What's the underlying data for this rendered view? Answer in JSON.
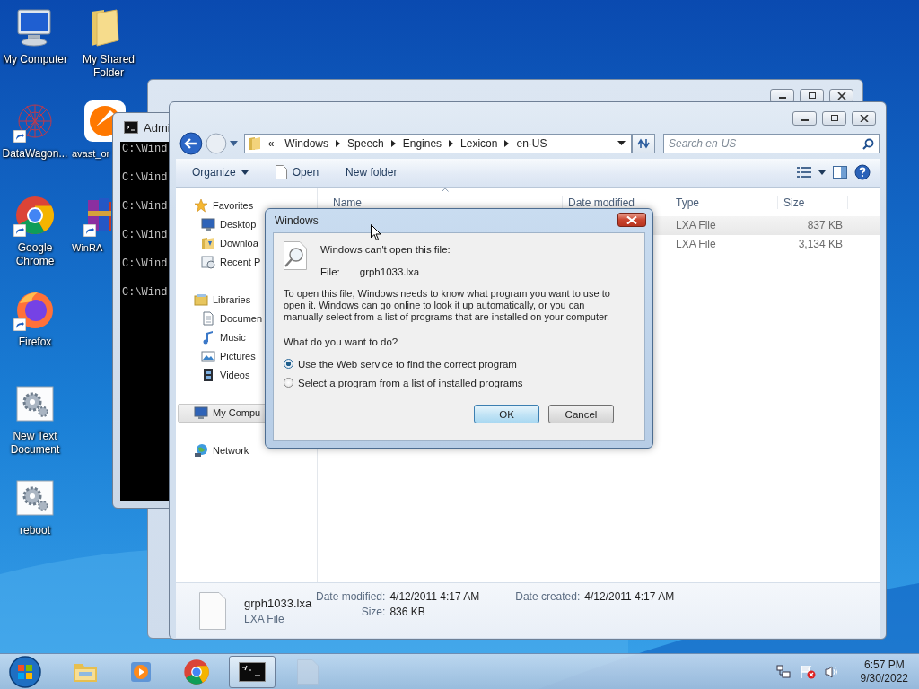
{
  "desktop_icons": [
    {
      "label": "My Computer",
      "shortcut": false
    },
    {
      "label": "DataWagon...",
      "shortcut": true
    },
    {
      "label": "Google Chrome",
      "shortcut": true
    },
    {
      "label": "Firefox",
      "shortcut": true
    },
    {
      "label": "New Text Document",
      "shortcut": false
    },
    {
      "label": "reboot",
      "shortcut": false
    },
    {
      "label": "My Shared Folder",
      "shortcut": false
    },
    {
      "label": "avast_or",
      "shortcut": false
    },
    {
      "label": "WinRA",
      "shortcut": true
    }
  ],
  "console_window": {
    "title": "Admi",
    "lines": [
      "C:\\Wind",
      "C:\\Wind",
      "C:\\Wind",
      "C:\\Wind",
      "C:\\Wind",
      "C:\\Wind"
    ]
  },
  "explorer": {
    "address": {
      "overflow_mark": "«",
      "crumbs": [
        "Windows",
        "Speech",
        "Engines",
        "Lexicon",
        "en-US"
      ]
    },
    "search": {
      "placeholder": "Search en-US"
    },
    "toolbar": [
      {
        "label": "Organize",
        "kind": "menu"
      },
      {
        "label": "Open",
        "kind": "open"
      },
      {
        "label": "New folder",
        "kind": "plain"
      }
    ],
    "nav": [
      {
        "label": "Favorites",
        "selected": false,
        "children": [
          {
            "label": "Desktop",
            "selected": false
          },
          {
            "label": "Downloa",
            "selected": false
          },
          {
            "label": "Recent P",
            "selected": false
          }
        ]
      },
      {
        "label": "Libraries",
        "selected": false,
        "children": [
          {
            "label": "Documen",
            "selected": false
          },
          {
            "label": "Music",
            "selected": false
          },
          {
            "label": "Pictures",
            "selected": false
          },
          {
            "label": "Videos",
            "selected": false
          }
        ]
      },
      {
        "label": "My Compu",
        "selected": true
      },
      {
        "label": "Network",
        "selected": false
      }
    ],
    "columns": [
      "Name",
      "Date modified",
      "Type",
      "Size"
    ],
    "rows": [
      {
        "type": "LXA File",
        "size": "837 KB",
        "selected": true
      },
      {
        "type": "LXA File",
        "size": "3,134 KB",
        "selected": false
      }
    ],
    "details": {
      "name": "grph1033.lxa",
      "type": "LXA File",
      "groups": [
        [
          {
            "label": "Date modified:",
            "value": "4/12/2011 4:17 AM"
          },
          {
            "label": "Size:",
            "value": "836 KB"
          }
        ],
        [
          {
            "label": "Date created:",
            "value": "4/12/2011 4:17 AM"
          }
        ]
      ]
    }
  },
  "dialog": {
    "title": "Windows",
    "heading": "Windows can't open this file:",
    "file_label": "File:",
    "file_name": "grph1033.lxa",
    "message": "To open this file, Windows needs to know what program you want to use to open it. Windows can go online to look it up automatically, or you can manually select from a list of programs that are installed on your computer.",
    "question": "What do you want to do?",
    "options": [
      {
        "label": "Use the Web service to find the correct program",
        "selected": true
      },
      {
        "label": "Select a program from a list of installed programs",
        "selected": false
      }
    ],
    "buttons": [
      {
        "label": "OK",
        "default": true
      },
      {
        "label": "Cancel",
        "default": false
      }
    ]
  },
  "taskbar": {
    "apps": [
      {
        "active": false
      },
      {
        "active": false
      },
      {
        "active": false
      },
      {
        "active": true
      },
      {
        "active": false
      }
    ],
    "clock": {
      "time": "6:57 PM",
      "date": "9/30/2022"
    }
  }
}
